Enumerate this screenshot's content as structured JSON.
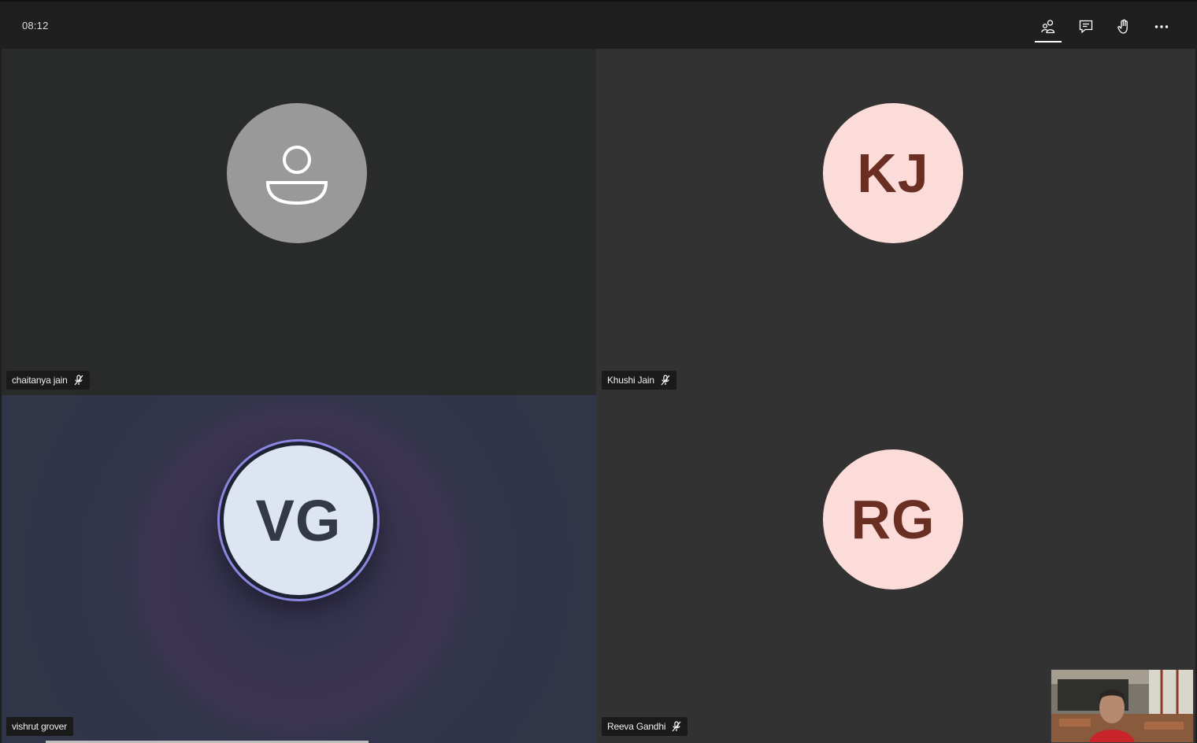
{
  "meeting": {
    "timer": "08:12"
  },
  "toolbar": {
    "buttons": [
      {
        "name": "participants",
        "icon": "people-icon",
        "active": true
      },
      {
        "name": "chat",
        "icon": "chat-icon"
      },
      {
        "name": "raise-hand",
        "icon": "hand-icon"
      },
      {
        "name": "more",
        "icon": "more-icon"
      }
    ]
  },
  "participants": [
    {
      "name": "chaitanya jain",
      "initials": "",
      "avatar": "generic-person-icon",
      "muted": true
    },
    {
      "name": "Khushi Jain",
      "initials": "KJ",
      "muted": true
    },
    {
      "name": "vishrut grover",
      "initials": "VG",
      "speaking": true
    },
    {
      "name": "Reeva Gandhi",
      "initials": "RG",
      "muted": true
    }
  ],
  "colors": {
    "topbar": "#1f1f1f",
    "avatar_peach": "#fbdcd9",
    "avatar_peach_text": "#6b2e22",
    "speaking_ring": "#8b86e0",
    "generic_avatar": "#999999"
  }
}
